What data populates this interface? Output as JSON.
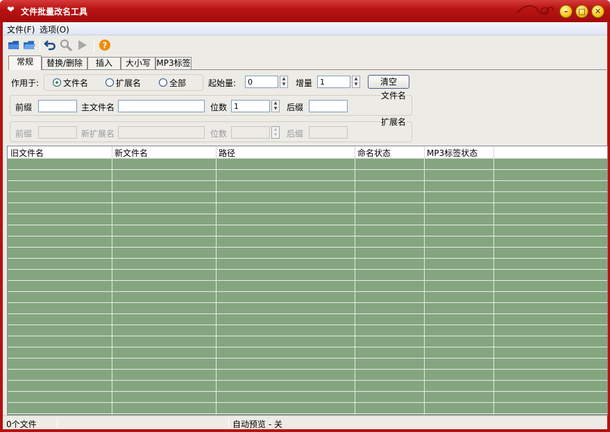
{
  "window": {
    "title": "文件批量改名工具"
  },
  "menu": [
    {
      "label": "文件(F)"
    },
    {
      "label": "选项(O)"
    }
  ],
  "toolbar": {
    "icons": [
      "open-file-icon",
      "open-folder-icon",
      "undo-icon",
      "search-icon",
      "run-icon",
      "help-icon"
    ],
    "accent": "#f08a00"
  },
  "tabs": [
    {
      "label": "常规",
      "active": true
    },
    {
      "label": "替换/删除"
    },
    {
      "label": "插入"
    },
    {
      "label": "大小写"
    },
    {
      "label": "MP3标签"
    }
  ],
  "general": {
    "apply_to_label": "作用于:",
    "radio_filename": "文件名",
    "radio_ext": "扩展名",
    "radio_all": "全部",
    "start_label": "起始量:",
    "start_value": "0",
    "increment_label": "增量",
    "increment_value": "1",
    "clear_button": "清空",
    "filename_group": {
      "title": "文件名",
      "prefix_label": "前缀",
      "prefix_value": "",
      "main_label": "主文件名",
      "main_value": "",
      "digits_label": "位数",
      "digits_value": "1",
      "suffix_label": "后缀",
      "suffix_value": ""
    },
    "ext_group": {
      "title": "扩展名",
      "prefix_label": "前缀",
      "new_ext_label": "新扩展名",
      "digits_label": "位数",
      "suffix_label": "后缀"
    }
  },
  "table": {
    "columns": [
      "旧文件名",
      "新文件名",
      "路径",
      "命名状态",
      "MP3标签状态"
    ],
    "row_count": 23,
    "bg_color": "#85a580"
  },
  "status": {
    "file_count": "0个文件",
    "preview": "自动预览 - 关"
  },
  "colors": {
    "titlebar": "#b91414",
    "grid": "#85a580"
  }
}
